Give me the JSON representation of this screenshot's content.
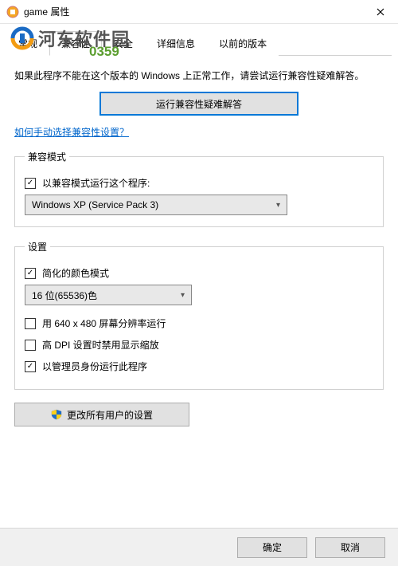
{
  "window": {
    "title": "game 属性"
  },
  "watermark": {
    "text": "河东软件园",
    "num": "0359"
  },
  "tabs": {
    "items": [
      {
        "label": "常规"
      },
      {
        "label": "兼容性"
      },
      {
        "label": "安全"
      },
      {
        "label": "详细信息"
      },
      {
        "label": "以前的版本"
      }
    ],
    "activeIndex": 1
  },
  "intro": "如果此程序不能在这个版本的 Windows 上正常工作，请尝试运行兼容性疑难解答。",
  "troubleshoot_btn": "运行兼容性疑难解答",
  "help_link": "如何手动选择兼容性设置？",
  "compat_mode": {
    "legend": "兼容模式",
    "check_label": "以兼容模式运行这个程序:",
    "checked": true,
    "select_value": "Windows XP (Service Pack 3)"
  },
  "settings": {
    "legend": "设置",
    "reduced_color": {
      "label": "简化的颜色模式",
      "checked": true
    },
    "color_select": "16 位(65536)色",
    "res640": {
      "label": "用 640 x 480 屏幕分辨率运行",
      "checked": false
    },
    "dpi": {
      "label": "高 DPI 设置时禁用显示缩放",
      "checked": false
    },
    "admin": {
      "label": "以管理员身份运行此程序",
      "checked": true
    }
  },
  "all_users_btn": "更改所有用户的设置",
  "footer": {
    "ok": "确定",
    "cancel": "取消"
  }
}
